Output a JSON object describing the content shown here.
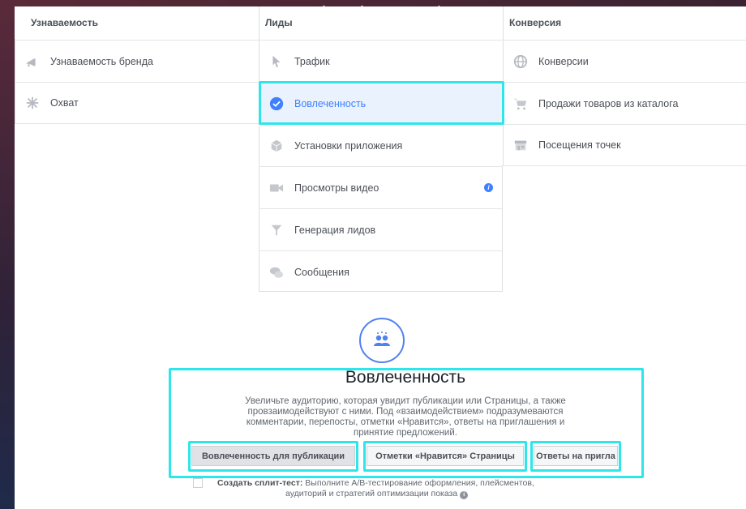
{
  "columns": {
    "awareness": {
      "title": "Узнаваемость",
      "items": [
        {
          "label": "Узнаваемость бренда",
          "icon": "megaphone-icon"
        },
        {
          "label": "Охват",
          "icon": "asterisk-icon"
        }
      ]
    },
    "leads": {
      "title": "Лиды",
      "items": [
        {
          "label": "Трафик",
          "icon": "cursor-icon"
        },
        {
          "label": "Вовлеченность",
          "icon": "check-circle-icon",
          "selected": true
        },
        {
          "label": "Установки приложения",
          "icon": "cube-icon"
        },
        {
          "label": "Просмотры видео",
          "icon": "video-camera-icon"
        },
        {
          "label": "Генерация лидов",
          "icon": "funnel-icon"
        },
        {
          "label": "Сообщения",
          "icon": "chat-bubbles-icon"
        }
      ]
    },
    "conversion": {
      "title": "Конверсия",
      "items": [
        {
          "label": "Конверсии",
          "icon": "globe-icon"
        },
        {
          "label": "Продажи товаров из каталога",
          "icon": "cart-icon"
        },
        {
          "label": "Посещения точек",
          "icon": "store-icon"
        }
      ]
    }
  },
  "detail": {
    "icon": "people-icon",
    "title": "Вовлеченность",
    "description_lines": [
      "Увеличьте аудиторию, которая увидит публикации или Страницы, а также",
      "провзаимодействуют с ними. Под «взаимодействием» подразумеваются",
      "комментарии, перепосты, отметки «Нравится», ответы на приглашения и",
      "принятие предложений."
    ],
    "buttons": [
      {
        "label": "Вовлеченность для публикации",
        "active": true
      },
      {
        "label": "Отметки «Нравится» Страницы",
        "active": false
      },
      {
        "label": "Ответы на пригла",
        "active": false
      }
    ]
  },
  "split_test": {
    "label": "Создать сплит-тест:",
    "text_line1": "Выполните A/B-тестирование оформления, плейсментов,",
    "text_line2": "аудиторий и стратегий оптимизации показа"
  },
  "colors": {
    "highlight": "#2ee6ea",
    "accent": "#4080ff",
    "selected_bg": "#eaf2fd"
  }
}
